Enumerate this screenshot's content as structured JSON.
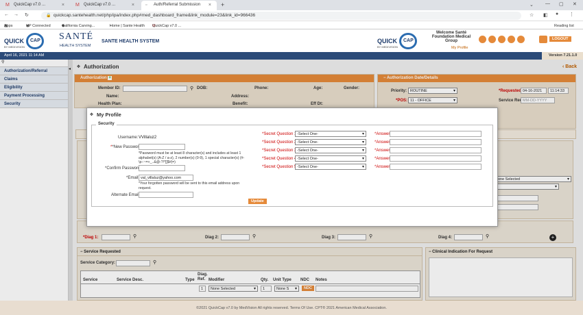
{
  "browser": {
    "tabs": [
      {
        "label": "QuickCap v7.0 ..."
      },
      {
        "label": "QuickCap v7.0 ..."
      },
      {
        "label": "Auth/Referral Submission"
      }
    ],
    "url": "quickcap.santehealth.net/php/ipa/index.php#med_dashboard_frame&link_module=23&link_id=966436",
    "bookmarks": [
      {
        "label": "Apps"
      },
      {
        "label": "HP Connected"
      },
      {
        "label": "California Carving..."
      },
      {
        "label": "Home | Sante Health"
      },
      {
        "label": "QuickCap v7.0 ..."
      }
    ],
    "reading_list": "Reading list"
  },
  "app": {
    "logo_quick": "QUICK",
    "logo_cap": "CAP",
    "logo_by": "BY MEDIVISION",
    "brand_name": "SANTÉ",
    "brand_sub": "HEALTH SYSTEM",
    "system_name": "SANTE HEALTH SYSTEM",
    "welcome": "Welcome Santé Foundation Medical Group",
    "my_profile_link": "My Profile",
    "logout": "LOGOUT",
    "date_time": "April 16, 2021 11:14 AM",
    "version": "Version 7.21.1.0"
  },
  "sidebar": {
    "items": [
      {
        "label": "Authorization/Referral"
      },
      {
        "label": "Claims"
      },
      {
        "label": "Eligibility"
      },
      {
        "label": "Payment Processing"
      },
      {
        "label": "Security"
      }
    ]
  },
  "page": {
    "title": "Authorization",
    "back": "Back",
    "auth_section": "Authorization",
    "fields": {
      "member_id": "Member ID:",
      "dob": "DOB:",
      "phone": "Phone:",
      "age": "Age:",
      "gender": "Gender:",
      "name": "Name:",
      "address": "Address:",
      "health_plan": "Health Plan:",
      "benefit": "Benefit:",
      "eff_dt": "Eff Dt:"
    },
    "auth_date_section": "Authorization Date/Details",
    "priority_label": "Priority:",
    "priority_value": "ROUTINE",
    "requested_dt_label": "*Requested Dt:",
    "requested_date": "04-16-2021",
    "requested_time": "11:14:33",
    "pos_label": "*POS:",
    "pos_value": "11 - OFFICE",
    "service_req_dt_label": "Service Req Dt:",
    "service_req_placeholder": "MM-DD-YYYY",
    "none_selected": "None Selected",
    "diag1": "*Diag 1:",
    "diag2": "Diag 2:",
    "diag3": "Diag 3:",
    "diag4": "Diag 4:",
    "service_requested": "Service Requested",
    "clinical_indication": "Clinical Indication For Request",
    "service_category": "Service Category:",
    "table_headers": [
      "Service",
      "Service Desc.",
      "Type",
      "Diag. Ref.",
      "Modifier",
      "Qty.",
      "Unit Type",
      "NDC",
      "Notes"
    ],
    "row": {
      "diag_ref": "1",
      "modifier": "None Selected",
      "qty": "1",
      "unit_type": "None S",
      "ndc": "NDC"
    }
  },
  "dialog": {
    "title": "My Profile",
    "section": "Security",
    "username_label": "Username:",
    "username_value": "VVillaluz2",
    "new_password_label": "*New Password:",
    "password_hint": "*Password must be at least 8 character(s) and includes at least 1 alphabet(s) (A-Z / a-z), 2 number(s) (0-9), 1 special character(s) (#-\\p-:~=+_..&@-?!*[]$#|=)",
    "confirm_password_label": "*Confirm Password:",
    "email_label": "*Email:",
    "email_value": "val_villaluz@yahoo.com",
    "email_hint": "*Your forgotten password will be sent to this email address upon request.",
    "alt_email_label": "Alternate Email:",
    "update": "Update",
    "questions": [
      {
        "label": "*Secret Question 1:",
        "value": "-Select One-",
        "answer": "*Answer:"
      },
      {
        "label": "*Secret Question 2:",
        "value": "-Select One-",
        "answer": "*Answer:"
      },
      {
        "label": "*Secret Question 3:",
        "value": "-Select One-",
        "answer": "*Answer:"
      },
      {
        "label": "*Secret Question 4:",
        "value": "-Select One-",
        "answer": "*Answer:"
      },
      {
        "label": "*Secret Question 5:",
        "value": "-Select One-",
        "answer": "*Answer:"
      }
    ]
  },
  "footer": {
    "text": "©2021 QuickCap v7.0 by MedVision All rights reserved. Terms Of Use. CPT® 2021 American Medical Association."
  },
  "colors": {
    "orange": "#e58a3a",
    "navy": "#2b4a78",
    "panel": "#eadfce"
  }
}
